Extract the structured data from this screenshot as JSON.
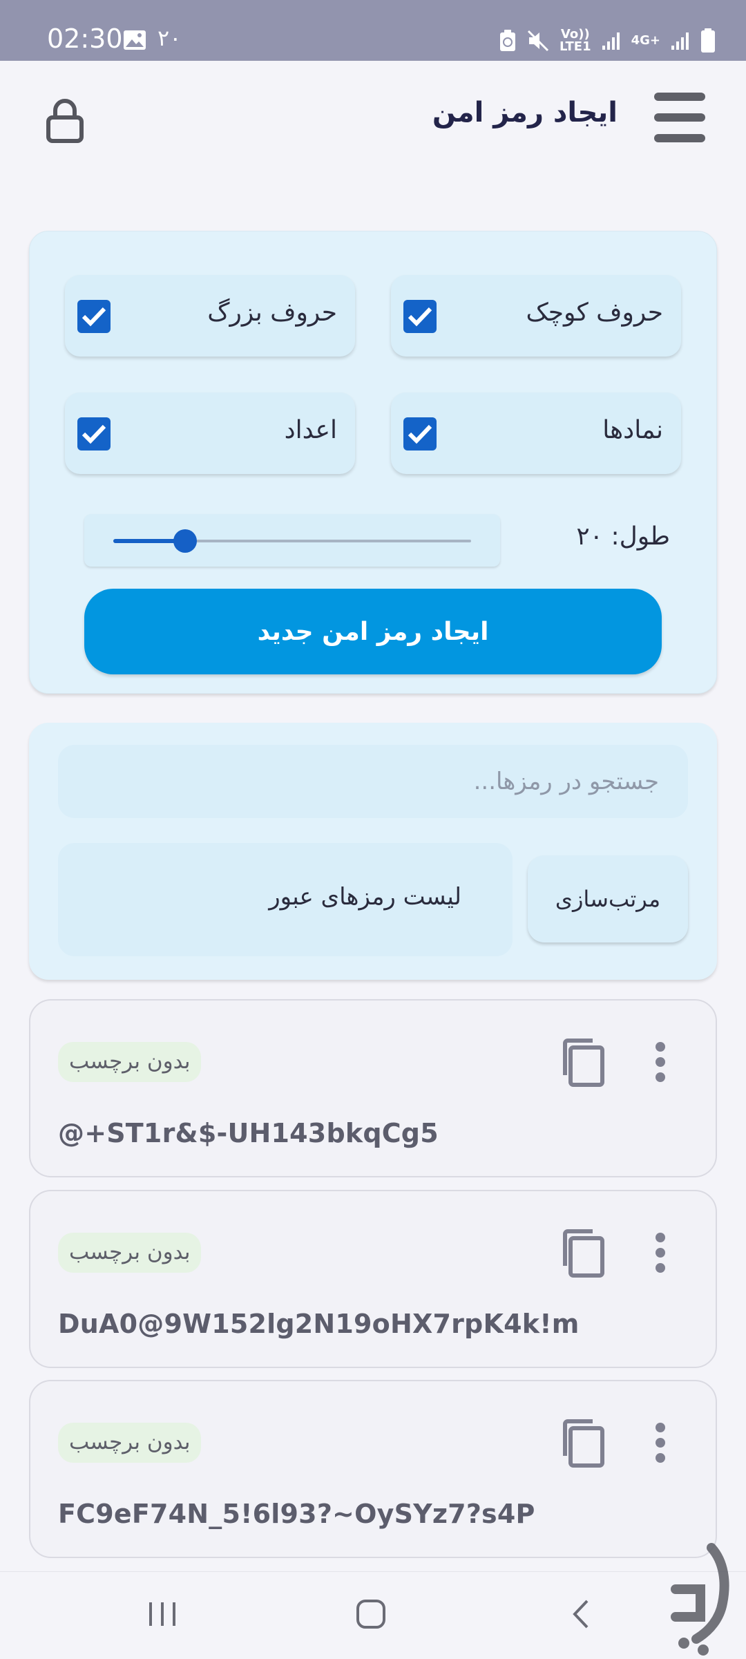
{
  "status_bar": {
    "time": "02:30",
    "notification_count": "۲۰",
    "network_label": "Vo))\nLTE1",
    "network_4g": "4G+"
  },
  "app_bar": {
    "title": "ایجاد رمز امن"
  },
  "generator": {
    "options": [
      {
        "label": "حروف کوچک",
        "checked": true
      },
      {
        "label": "حروف بزرگ",
        "checked": true
      },
      {
        "label": "نمادها",
        "checked": true
      },
      {
        "label": "اعداد",
        "checked": true
      }
    ],
    "length_label": "طول: ۲۰",
    "length_value": 20,
    "length_fraction": 0.2,
    "generate_button": "ایجاد رمز امن جدید"
  },
  "list": {
    "search_placeholder": "جستجو در رمزها...",
    "title": "لیست رمزهای عبور",
    "sort_button": "مرتب‌سازی"
  },
  "passwords": [
    {
      "tag": "بدون برچسب",
      "value": "@+ST1r&$-UH143bkqCg5"
    },
    {
      "tag": "بدون برچسب",
      "value": "DuA0@9W152lg2N19oHX7rpK4k!m"
    },
    {
      "tag": "بدون برچسب",
      "value": "FC9eF74N_5!6l93?~OySYz7?s4P"
    }
  ],
  "colors": {
    "accent": "#0296e0",
    "checkbox": "#1463c8",
    "card_bg": "#e1f2fb",
    "status_bar": "#9294ae"
  }
}
